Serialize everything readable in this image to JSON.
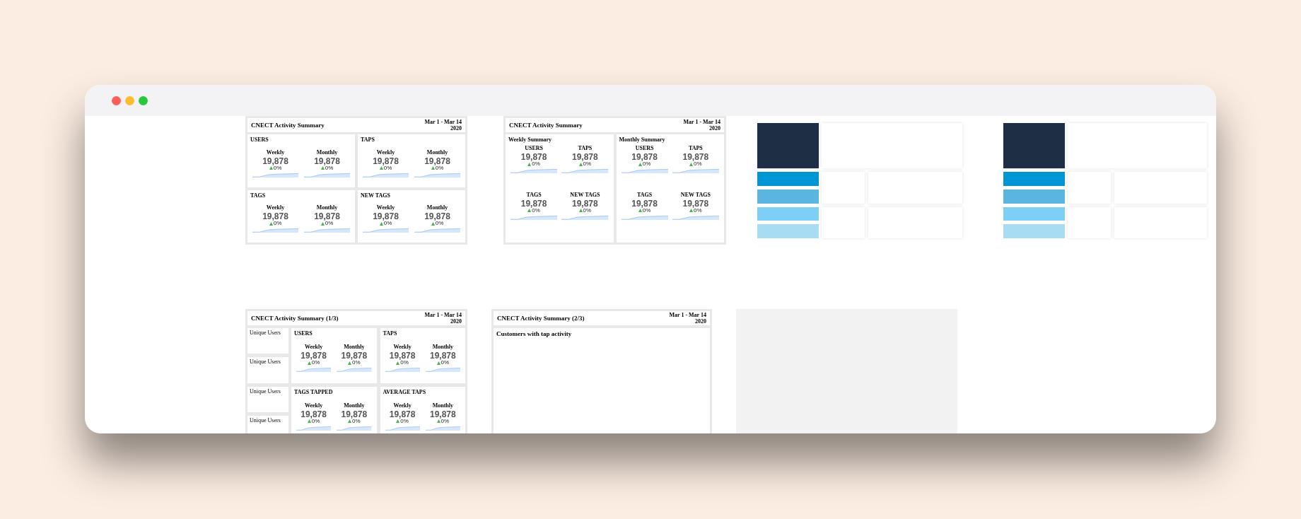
{
  "window": {
    "controls": [
      {
        "color": "#ff5f57"
      },
      {
        "color": "#febc2e"
      },
      {
        "color": "#28c840"
      }
    ]
  },
  "boards": [
    {
      "kind": "grid",
      "title": "CNECT Activity Summary",
      "date": "Mar 1 - Mar 14",
      "year": "2020",
      "cards": [
        {
          "title": "USERS",
          "metrics": [
            {
              "label": "Weekly",
              "value": "19,878",
              "change": "0%"
            },
            {
              "label": "Monthly",
              "value": "19,878",
              "change": "0%"
            }
          ]
        },
        {
          "title": "TAPS",
          "metrics": [
            {
              "label": "Weekly",
              "value": "19,878",
              "change": "0%"
            },
            {
              "label": "Monthly",
              "value": "19,878",
              "change": "0%"
            }
          ]
        },
        {
          "title": "TAGS",
          "metrics": [
            {
              "label": "Weekly",
              "value": "19,878",
              "change": "0%"
            },
            {
              "label": "Monthly",
              "value": "19,878",
              "change": "0%"
            }
          ]
        },
        {
          "title": "NEW TAGS",
          "metrics": [
            {
              "label": "Weekly",
              "value": "19,878",
              "change": "0%"
            },
            {
              "label": "Monthly",
              "value": "19,878",
              "change": "0%"
            }
          ]
        }
      ]
    },
    {
      "kind": "summary",
      "title": "CNECT Activity Summary",
      "date": "Mar 1 - Mar 14",
      "year": "2020",
      "cards": [
        {
          "title": "Weekly Summary",
          "metrics": [
            {
              "label": "USERS",
              "value": "19,878",
              "change": "0%"
            },
            {
              "label": "TAPS",
              "value": "19,878",
              "change": "0%"
            },
            {
              "label": "TAGS",
              "value": "19,878",
              "change": "0%"
            },
            {
              "label": "NEW TAGS",
              "value": "19,878",
              "change": "0%"
            }
          ]
        },
        {
          "title": "Monthly Summary",
          "metrics": [
            {
              "label": "USERS",
              "value": "19,878",
              "change": "0%"
            },
            {
              "label": "TAPS",
              "value": "19,878",
              "change": "0%"
            },
            {
              "label": "TAGS",
              "value": "19,878",
              "change": "0%"
            },
            {
              "label": "NEW TAGS",
              "value": "19,878",
              "change": "0%"
            }
          ]
        }
      ]
    },
    {
      "kind": "tiles",
      "bars": [
        {
          "color": "#0096d6"
        },
        {
          "color": "#5ab6e0"
        },
        {
          "color": "#7dcff4"
        },
        {
          "color": "#a8dcf2"
        }
      ]
    },
    {
      "kind": "tiles",
      "bars": [
        {
          "color": "#0096d6"
        },
        {
          "color": "#5ab6e0"
        },
        {
          "color": "#7dcff4"
        },
        {
          "color": "#a8dcf2"
        }
      ]
    },
    {
      "kind": "sidebar",
      "title": "CNECT Activity Summary (1/3)",
      "date": "Mar 1 - Mar 14",
      "year": "2020",
      "side_cards": [
        {
          "title": "Unique Users"
        },
        {
          "title": "Unique Users"
        },
        {
          "title": "Unique Users"
        },
        {
          "title": "Unique Users"
        }
      ],
      "cards": [
        {
          "title": "USERS",
          "metrics": [
            {
              "label": "Weekly",
              "value": "19,878",
              "change": "0%"
            },
            {
              "label": "Monthly",
              "value": "19,878",
              "change": "0%"
            }
          ]
        },
        {
          "title": "TAPS",
          "metrics": [
            {
              "label": "Weekly",
              "value": "19,878",
              "change": "0%"
            },
            {
              "label": "Monthly",
              "value": "19,878",
              "change": "0%"
            }
          ]
        },
        {
          "title": "TAGS TAPPED",
          "metrics": [
            {
              "label": "Weekly",
              "value": "19,878",
              "change": "0%"
            },
            {
              "label": "Monthly",
              "value": "19,878",
              "change": "0%"
            }
          ]
        },
        {
          "title": "AVERAGE TAPS",
          "metrics": [
            {
              "label": "Weekly",
              "value": "19,878",
              "change": "0%"
            },
            {
              "label": "Monthly",
              "value": "19,878",
              "change": "0%"
            }
          ]
        }
      ]
    },
    {
      "kind": "single",
      "title": "CNECT Activity Summary (2/3)",
      "date": "Mar 1 - Mar 14",
      "year": "2020",
      "section_title": "Customers with tap activity"
    },
    {
      "kind": "blank"
    }
  ]
}
